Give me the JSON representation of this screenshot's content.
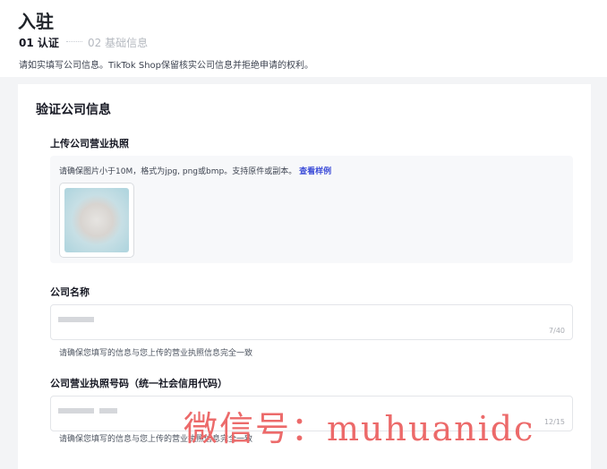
{
  "header": {
    "title": "入驻",
    "steps": [
      {
        "label": "01 认证",
        "active": true
      },
      {
        "label": "02 基础信息",
        "active": false
      }
    ],
    "notice": "请如实填写公司信息。TikTok Shop保留核实公司信息并拒绝申请的权利。"
  },
  "form": {
    "section_title": "验证公司信息",
    "license_upload": {
      "label": "上传公司营业执照",
      "hint": "请确保图片小于10M，格式为jpg, png或bmp。支持原件或副本。",
      "link": "查看样例"
    },
    "company_name": {
      "label": "公司名称",
      "counter": "7/40",
      "helper": "请确保您填写的信息与您上传的营业执照信息完全一致"
    },
    "license_number": {
      "label": "公司营业执照号码（统一社会信用代码）",
      "counter": "12/15",
      "helper": "请确保您填写的信息与您上传的营业执照信息完全一致"
    }
  },
  "watermark": "微信号：muhuanidc",
  "colors": {
    "link": "#3b4bd8",
    "watermark": "#ec6a6a",
    "page_bg": "#f3f4f6"
  }
}
